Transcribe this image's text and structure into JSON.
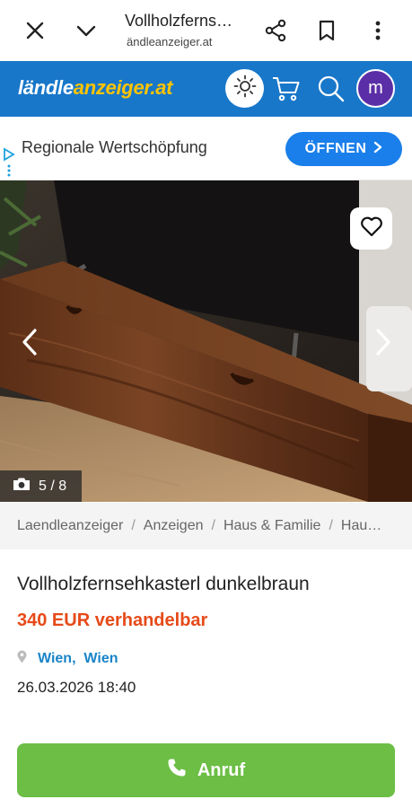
{
  "browser": {
    "title": "Vollholzferns…",
    "url": "ändleanzeiger.at"
  },
  "header": {
    "logo_part1": "ländle",
    "logo_part2": "anzeiger.at",
    "avatar_letter": "m",
    "brand_color": "#1877c9",
    "logo_accent_color": "#ffc400"
  },
  "ad": {
    "text": "Regionale Wertschöpfung",
    "button_label": "ÖFFNEN"
  },
  "gallery": {
    "counter": "5 / 8"
  },
  "breadcrumb": [
    "Laendleanzeiger",
    "Anzeigen",
    "Haus & Familie",
    "Hau…"
  ],
  "listing": {
    "title": "Vollholzfernsehkasterl dunkelbraun",
    "price": "340 EUR verhandelbar",
    "location_city": "Wien,",
    "location_region": "Wien",
    "date": "26.03.2026 18:40",
    "price_color": "#e64a19"
  },
  "actions": {
    "call_label": "Anruf",
    "call_color": "#6cbe45"
  },
  "icons": [
    "close-icon",
    "chevron-down-icon",
    "share-icon",
    "bookmark-icon",
    "more-vert-icon",
    "sun-icon",
    "cart-icon",
    "search-icon",
    "adchoices-icon",
    "heart-icon",
    "chevron-left-icon",
    "chevron-right-icon",
    "camera-icon",
    "map-pin-icon",
    "phone-icon"
  ]
}
